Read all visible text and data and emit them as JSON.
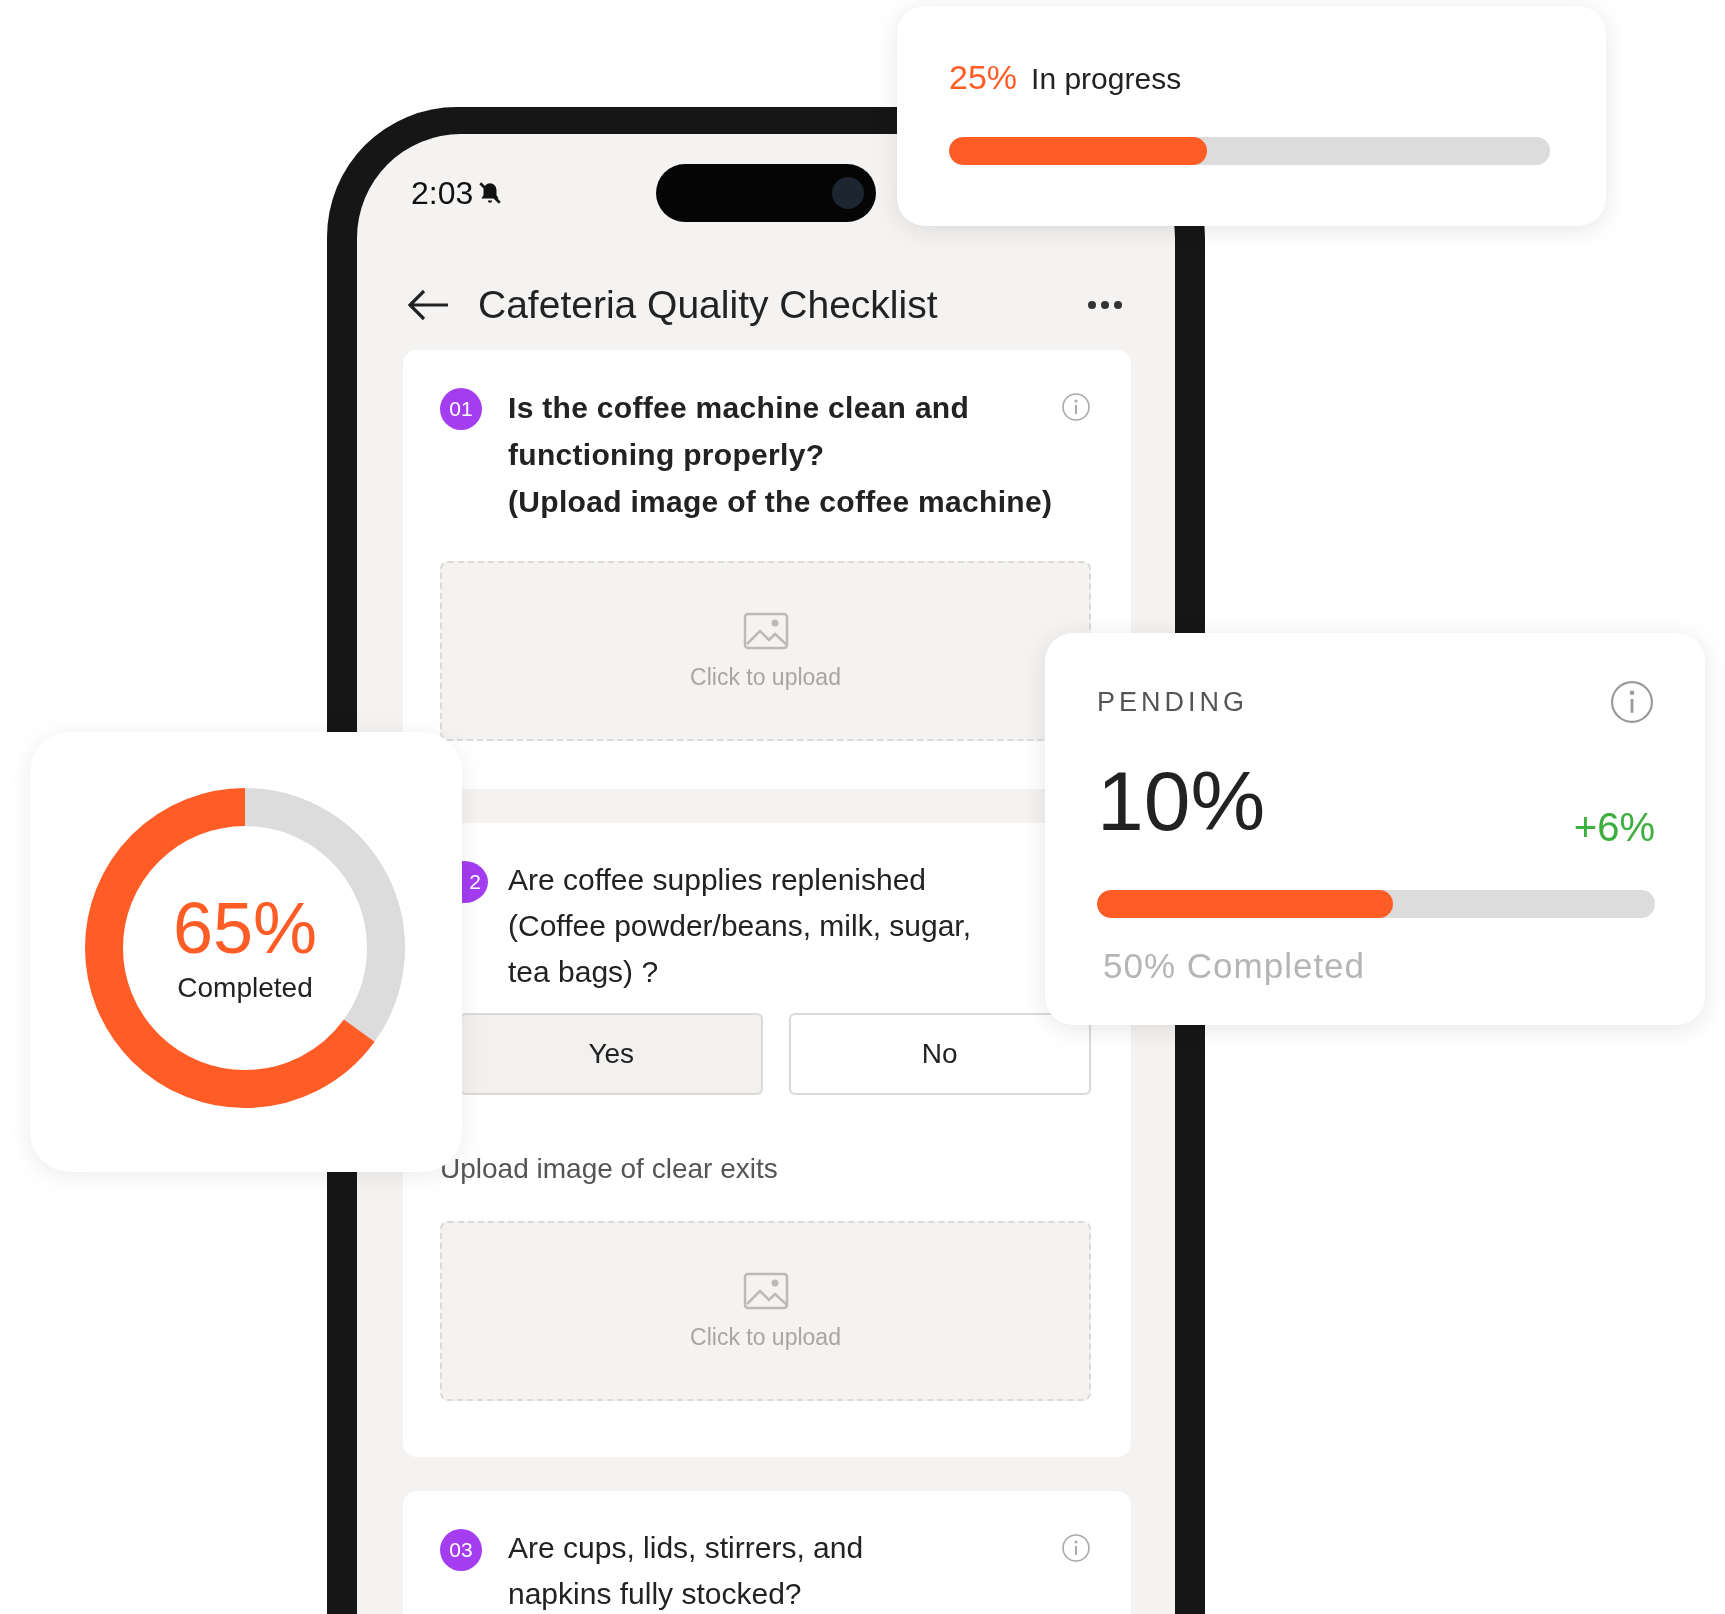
{
  "status_bar": {
    "time": "2:03"
  },
  "header": {
    "title": "Cafeteria Quality Checklist"
  },
  "questions": [
    {
      "number": "01",
      "kind": "upload",
      "info": true,
      "lines": [
        "Is the coffee machine clean and",
        "functioning properly?",
        "(Upload image of the coffee machine)"
      ],
      "upload_label": "Click to upload"
    },
    {
      "number": "2",
      "kind": "choice",
      "info": false,
      "lines": [
        "Are coffee supplies replenished",
        "(Coffee powder/beans, milk, sugar,",
        "tea bags) ?"
      ],
      "options": [
        {
          "label": "Yes",
          "selected": true
        },
        {
          "label": "No",
          "selected": false
        }
      ],
      "upload_prompt": "Upload image of clear exits",
      "upload_label": "Click to upload"
    },
    {
      "number": "03",
      "kind": "plain",
      "info": true,
      "lines": [
        "Are cups, lids, stirrers, and",
        "napkins fully stocked?"
      ]
    }
  ],
  "progress_card": {
    "percent": "25%",
    "label": "In progress",
    "level": 0.43
  },
  "pending_card": {
    "title": "PENDING",
    "value": "10%",
    "change": "+6%",
    "level": 0.53,
    "caption": "50% Completed"
  },
  "donut_card": {
    "percent": "65%",
    "label": "Completed",
    "level": 0.65
  }
}
